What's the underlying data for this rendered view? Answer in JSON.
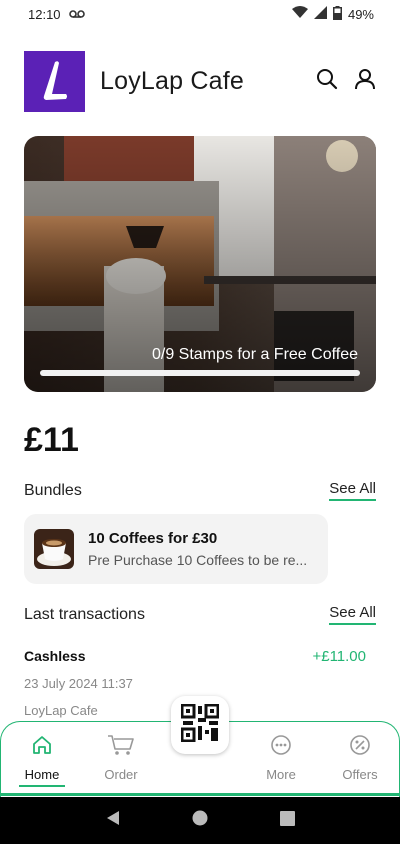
{
  "status_bar": {
    "time": "12:10",
    "battery": "49%"
  },
  "header": {
    "cafe_name": "LoyLap Cafe"
  },
  "hero": {
    "stamps_text": "0/9 Stamps for a Free Coffee",
    "stamps_progress": 0
  },
  "balance": "£11",
  "bundles": {
    "title": "Bundles",
    "see_all": "See All",
    "items": [
      {
        "title": "10 Coffees for £30",
        "subtitle": "Pre Purchase 10 Coffees to be re..."
      }
    ]
  },
  "transactions": {
    "title": "Last transactions",
    "see_all": "See All",
    "items": [
      {
        "type": "Cashless",
        "amount": "+£11.00",
        "date": "23 July 2024 11:37",
        "venue": "LoyLap Cafe"
      }
    ]
  },
  "bottom_nav": {
    "home": "Home",
    "order": "Order",
    "more": "More",
    "offers": "Offers"
  },
  "colors": {
    "accent": "#22b573",
    "brand": "#5b21b6"
  }
}
